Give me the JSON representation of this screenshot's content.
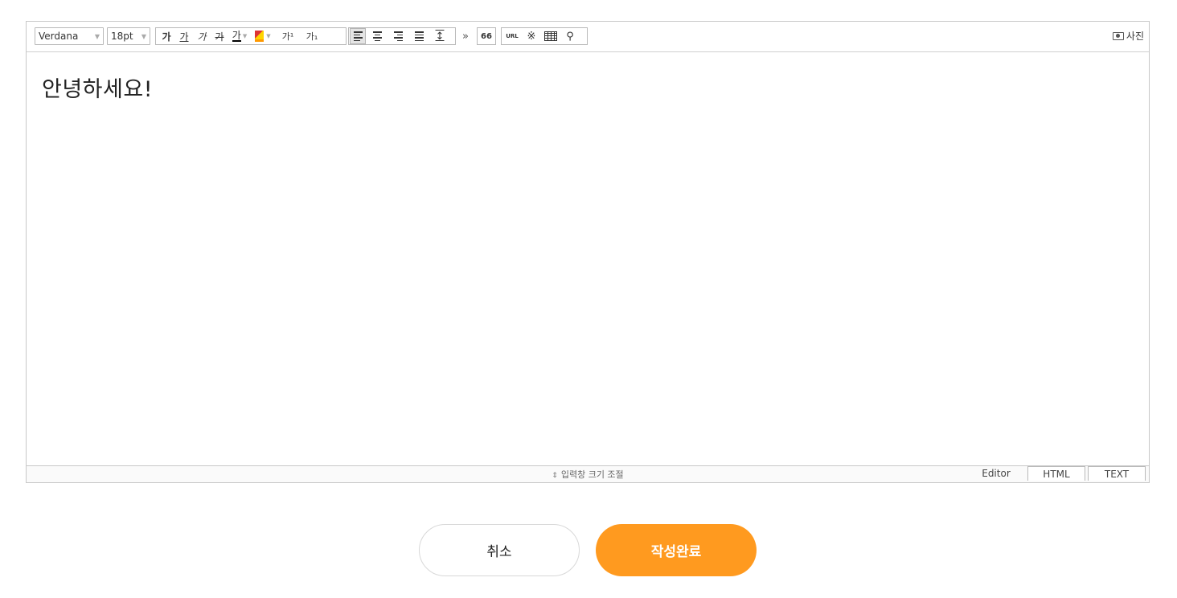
{
  "toolbar": {
    "font_family": "Verdana",
    "font_size": "18pt",
    "bold": "가",
    "underline": "가",
    "italic": "가",
    "strike": "가",
    "text_color": "가",
    "sup": "가¹",
    "sub": "가₁",
    "more": "»",
    "quote": "66",
    "url": "URL",
    "special": "※",
    "search": "⚲",
    "photo": "사진"
  },
  "content": {
    "text": "안녕하세요!"
  },
  "status": {
    "resize_label": "입력창 크기 조절",
    "resize_glyph": "⇕"
  },
  "mode_tabs": [
    "Editor",
    "HTML",
    "TEXT"
  ],
  "buttons": {
    "cancel": "취소",
    "submit": "작성완료"
  },
  "colors": {
    "accent": "#ff9a1f",
    "border": "#c8c8c8"
  }
}
